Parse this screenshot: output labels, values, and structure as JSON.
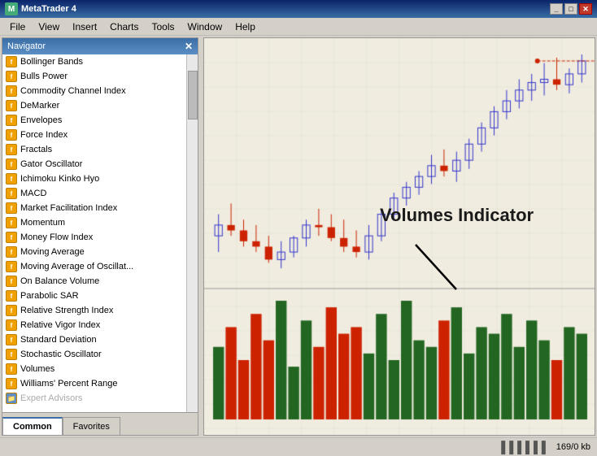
{
  "titleBar": {
    "title": "MetaTrader 4",
    "buttons": {
      "minimize": "_",
      "maximize": "□",
      "close": "✕"
    }
  },
  "menuBar": {
    "items": [
      "File",
      "View",
      "Insert",
      "Charts",
      "Tools",
      "Window",
      "Help"
    ]
  },
  "innerWindow": {
    "title": "",
    "buttons": {
      "minimize": "_",
      "maximize": "□",
      "close": "✕"
    }
  },
  "navigator": {
    "title": "Navigator",
    "items": [
      "Bollinger Bands",
      "Bulls Power",
      "Commodity Channel Index",
      "DeMarker",
      "Envelopes",
      "Force Index",
      "Fractals",
      "Gator Oscillator",
      "Ichimoku Kinko Hyo",
      "MACD",
      "Market Facilitation Index",
      "Momentum",
      "Money Flow Index",
      "Moving Average",
      "Moving Average of Oscillat...",
      "On Balance Volume",
      "Parabolic SAR",
      "Relative Strength Index",
      "Relative Vigor Index",
      "Standard Deviation",
      "Stochastic Oscillator",
      "Volumes",
      "Williams' Percent Range"
    ],
    "tabs": {
      "common": "Common",
      "favorites": "Favorites"
    },
    "activeTab": "common"
  },
  "chart": {
    "volumesLabel": "Volumes Indicator"
  },
  "statusBar": {
    "memoryUsage": "169/0 kb",
    "icon": "▌▌▌▌▌▌"
  }
}
